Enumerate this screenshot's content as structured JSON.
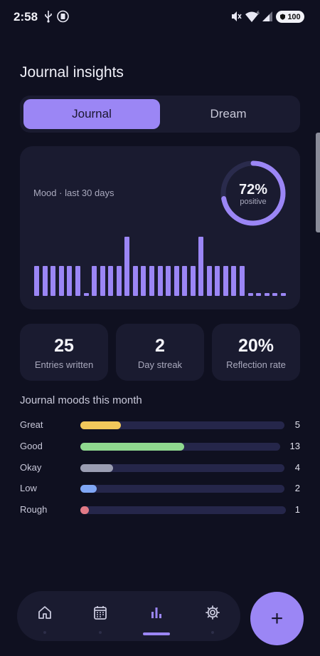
{
  "status_bar": {
    "time": "2:58",
    "battery": "100"
  },
  "header": {
    "title": "Journal insights"
  },
  "tabs": [
    {
      "label": "Journal",
      "selected": true
    },
    {
      "label": "Dream",
      "selected": false
    }
  ],
  "mood_card": {
    "label": "Mood · last 30 days",
    "positive_percent": "72%",
    "positive_label": "positive",
    "positive_fraction": 0.72
  },
  "chart_data": {
    "type": "bar",
    "title": "Mood · last 30 days",
    "values": [
      3,
      3,
      3,
      3,
      3,
      3,
      0.3,
      3,
      3,
      3,
      3,
      6,
      3,
      3,
      3,
      3,
      3,
      3,
      3,
      3,
      6,
      3,
      3,
      3,
      3,
      3,
      0.3,
      0.3,
      0.3,
      0.3,
      0.3
    ],
    "ylim": [
      0,
      6.5
    ],
    "color": "#9b86f5"
  },
  "stats": [
    {
      "value": "25",
      "label": "Entries written"
    },
    {
      "value": "2",
      "label": "Day streak"
    },
    {
      "value": "20%",
      "label": "Reflection rate"
    }
  ],
  "moods_section": {
    "title": "Journal moods this month",
    "items": [
      {
        "name": "Great",
        "count": "5",
        "fraction": 0.2,
        "color": "#f1c85b"
      },
      {
        "name": "Good",
        "count": "13",
        "fraction": 0.52,
        "color": "#8fd88f"
      },
      {
        "name": "Okay",
        "count": "4",
        "fraction": 0.16,
        "color": "#9a9db2"
      },
      {
        "name": "Low",
        "count": "2",
        "fraction": 0.08,
        "color": "#7fa6f5"
      },
      {
        "name": "Rough",
        "count": "1",
        "fraction": 0.04,
        "color": "#e27a86"
      }
    ]
  },
  "bottom_nav": {
    "items": [
      "home-icon",
      "calendar-icon",
      "bar-chart-icon",
      "gear-icon"
    ],
    "active": 2
  },
  "fab": {
    "label": "+"
  },
  "colors": {
    "accent": "#9b86f5",
    "background": "#0f1020",
    "card": "#1a1b30"
  }
}
